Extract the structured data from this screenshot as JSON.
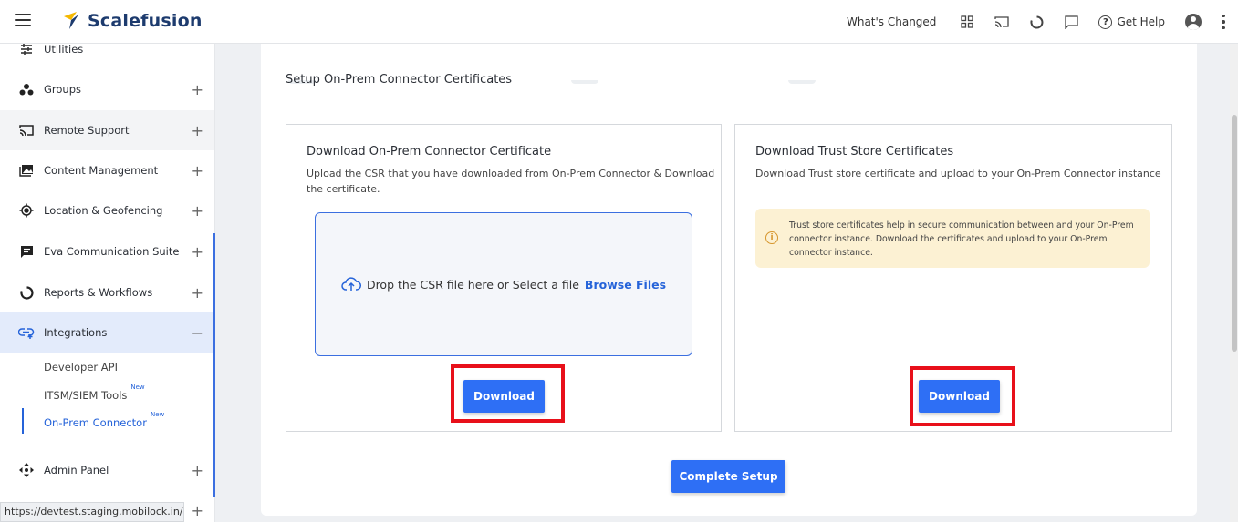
{
  "header": {
    "brand": "Scalefusion",
    "whats_changed": "What's Changed",
    "get_help": "Get Help",
    "icons": [
      "hamburger-icon",
      "apps-grid-icon",
      "cast-icon",
      "loading-circle-icon",
      "chat-icon",
      "help-icon",
      "user-avatar-icon",
      "more-vertical-icon"
    ],
    "brand_colors": {
      "navy": "#1d3b6e",
      "yellow": "#f5b800",
      "accent": "#2e6ff5"
    }
  },
  "sidebar": {
    "items": [
      {
        "label": "Utilities",
        "icon": "sliders-icon",
        "expander": ""
      },
      {
        "label": "Groups",
        "icon": "groups-icon",
        "expander": "+"
      },
      {
        "label": "Remote Support",
        "icon": "cast-icon",
        "expander": "+"
      },
      {
        "label": "Content Management",
        "icon": "image-icon",
        "expander": "+"
      },
      {
        "label": "Location & Geofencing",
        "icon": "location-target-icon",
        "expander": "+"
      },
      {
        "label": "Eva Communication Suite",
        "icon": "message-icon",
        "expander": "+"
      },
      {
        "label": "Reports & Workflows",
        "icon": "report-circle-icon",
        "expander": "+"
      },
      {
        "label": "Integrations",
        "icon": "integration-icon",
        "expander": "−"
      },
      {
        "label": "Admin Panel",
        "icon": "move-arrows-icon",
        "expander": "+"
      }
    ],
    "subitems": [
      {
        "label": "Developer API",
        "badge": ""
      },
      {
        "label": "ITSM/SIEM Tools",
        "badge": "New"
      },
      {
        "label": "On-Prem Connector",
        "badge": "New"
      }
    ],
    "extra_expander": "+"
  },
  "status_url": "https://devtest.staging.mobilock.in/#",
  "main": {
    "section_title": "Setup On-Prem Connector Certificates",
    "left_panel": {
      "title": "Download On-Prem Connector Certificate",
      "desc_line1": "Upload the CSR that you have downloaded from On-Prem Connector & Download",
      "desc_line2": "the certificate.",
      "drop_text": "Drop the CSR file here or Select a file",
      "browse_label": "Browse Files",
      "button_label": "Download"
    },
    "right_panel": {
      "title": "Download Trust Store Certificates",
      "desc": "Download Trust store certificate and upload to your On-Prem Connector instance",
      "info_line1": "Trust store certificates help in secure communication between and your On-Prem",
      "info_line2": "connector instance. Download the certificates and upload to your On-Prem",
      "info_line3": "connector instance.",
      "button_label": "Download"
    },
    "complete_label": "Complete Setup"
  }
}
